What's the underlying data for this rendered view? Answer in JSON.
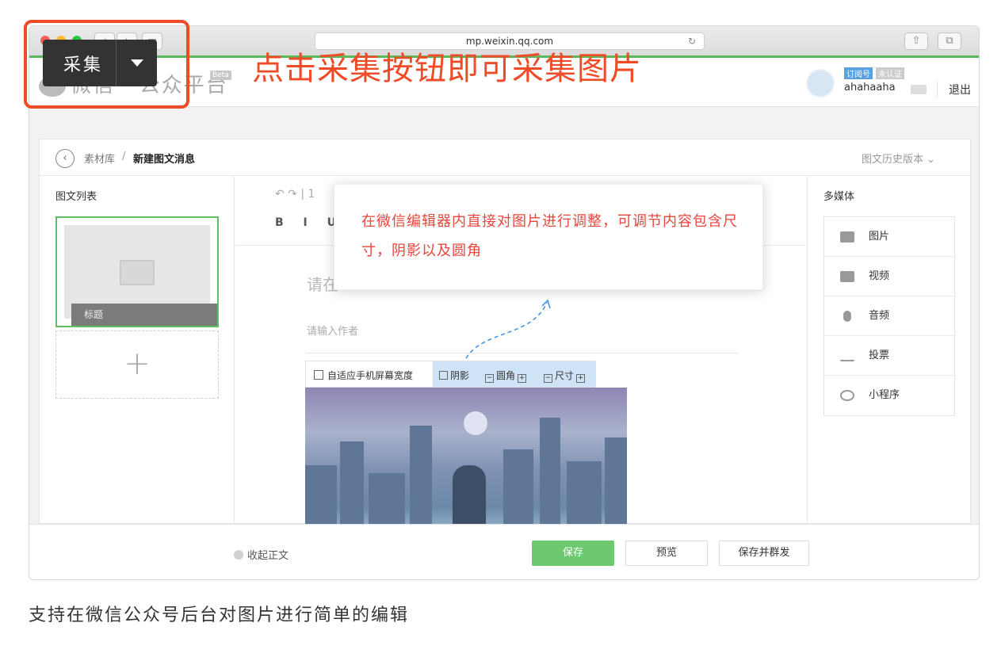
{
  "browser": {
    "url": "mp.weixin.qq.com",
    "back": "‹",
    "forward": "›",
    "reload": "↻",
    "share": "⇧",
    "tabs": "⧉"
  },
  "mp_header": {
    "logo_text": "微信 · 公众平台",
    "beta": "Beta",
    "badge_subscription": "订阅号",
    "badge_unverified": "未认证",
    "username": "ahahaaha",
    "logout": "退出"
  },
  "breadcrumb": {
    "back": "‹",
    "parent": "素材库",
    "separator": "/",
    "current": "新建图文消息",
    "history": "图文历史版本 ⌄"
  },
  "left": {
    "title": "图文列表",
    "card_title": "标题",
    "add": "+"
  },
  "editor": {
    "undo_redo": "↶  ↷  |  1",
    "format": "B I U A",
    "title_placeholder": "请在",
    "author_placeholder": "请输入作者",
    "img_toolbar": {
      "adapt": "自适应手机屏幕宽度",
      "shadow": "阴影",
      "radius": "圆角",
      "size": "尺寸"
    }
  },
  "right": {
    "title": "多媒体",
    "items": [
      "图片",
      "视频",
      "音频",
      "投票",
      "小程序"
    ]
  },
  "footer": {
    "collapse": "收起正文",
    "save": "保存",
    "preview": "预览",
    "save_mass": "保存并群发"
  },
  "tooltip": "在微信编辑器内直接对图片进行调整，可调节内容包含尺寸，阴影以及圆角",
  "collector": {
    "label": "采集"
  },
  "headline": "点击采集按钮即可采集图片",
  "caption": "支持在微信公众号后台对图片进行简单的编辑",
  "colors": {
    "accent_red": "#f04b27",
    "save_green": "#6cc96e",
    "tooltip_red": "#e8453c"
  }
}
